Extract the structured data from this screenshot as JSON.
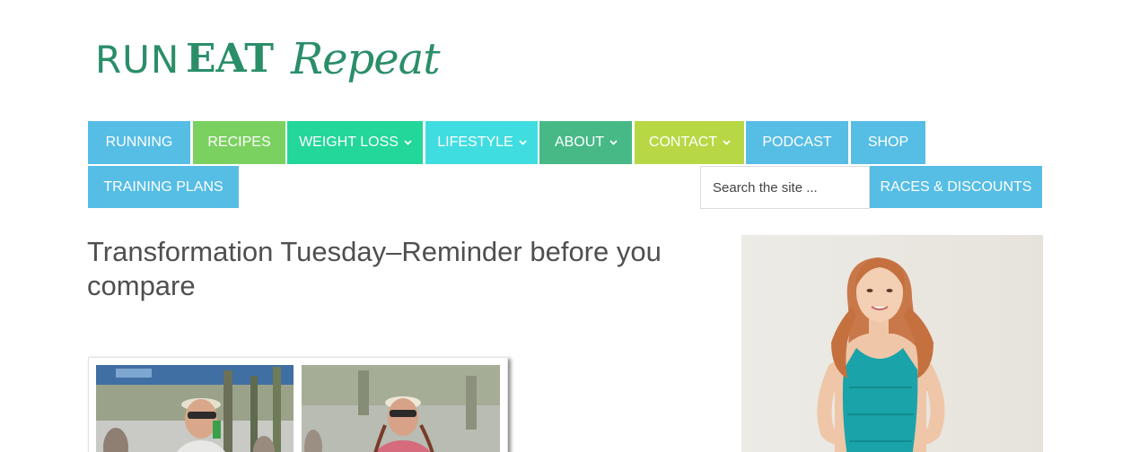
{
  "logo": {
    "run": "RUN",
    "eat": "EAT",
    "repeat": "Repeat",
    "color": "#2a8e69"
  },
  "nav": {
    "items": [
      {
        "label": "RUNNING",
        "color": "#56bde5",
        "dropdown": false
      },
      {
        "label": "RECIPES",
        "color": "#7bd160",
        "dropdown": false
      },
      {
        "label": "WEIGHT LOSS",
        "color": "#23d69a",
        "dropdown": true
      },
      {
        "label": "LIFESTYLE",
        "color": "#40dde0",
        "dropdown": true
      },
      {
        "label": "ABOUT",
        "color": "#47b987",
        "dropdown": true
      },
      {
        "label": "CONTACT",
        "color": "#b7d844",
        "dropdown": true
      },
      {
        "label": "PODCAST",
        "color": "#56bde5",
        "dropdown": false
      },
      {
        "label": "SHOP",
        "color": "#56bde5",
        "dropdown": false
      },
      {
        "label": "TRAINING PLANS",
        "color": "#56bde5",
        "dropdown": false
      }
    ],
    "search_placeholder": "Search the site ...",
    "races_label": "RACES & DISCOUNTS"
  },
  "post": {
    "title": "Transformation Tuesday–Reminder before you compare",
    "image_description_icon": "runner-comparison-photo"
  },
  "sidebar": {
    "photo_icon": "author-portrait-photo"
  }
}
